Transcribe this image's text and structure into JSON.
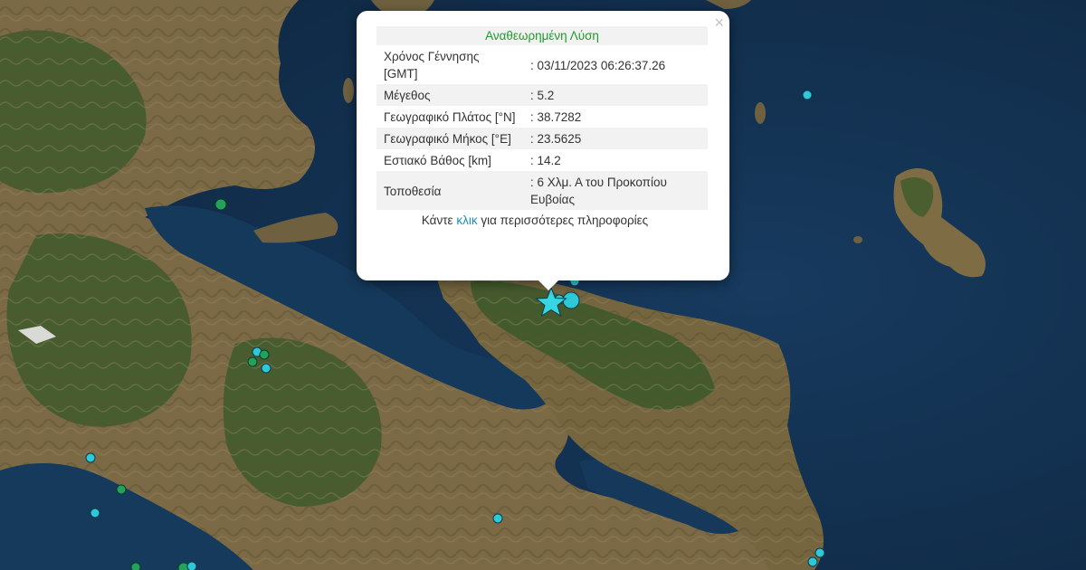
{
  "popup": {
    "title": "Αναθεωρημένη Λύση",
    "close_symbol": "×",
    "rows": [
      {
        "label": "Χρόνος Γέννησης [GMT]",
        "value": ": 03/11/2023 06:26:37.26"
      },
      {
        "label": "Μέγεθος",
        "value": ": 5.2"
      },
      {
        "label": "Γεωγραφικό Πλάτος [°N]",
        "value": ": 38.7282"
      },
      {
        "label": "Γεωγραφικό Μήκος [°E]",
        "value": ": 23.5625"
      },
      {
        "label": "Εστιακό Βάθος [km]",
        "value": ": 14.2"
      },
      {
        "label": "Τοποθεσία",
        "value": ": 6 Χλμ. Α του Προκοπίου Ευβοίας"
      }
    ],
    "more_prefix": "Κάντε ",
    "more_link": "κλικ",
    "more_suffix": " για περισσότερες πληροφορίες"
  },
  "map": {
    "colors": {
      "sea": "#143354",
      "land": "#7a6a45",
      "vegetation": "#3f5a2c",
      "epicenter_star": "#37d6e3",
      "event_recent": "#2ec9d8",
      "event_older": "#23a35a"
    },
    "main_event_icon": "star-icon"
  }
}
